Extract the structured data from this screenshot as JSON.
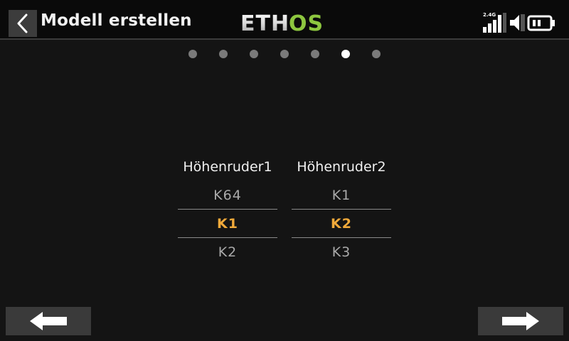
{
  "header": {
    "title": "Modell erstellen",
    "brand": {
      "part1": "ETH",
      "part2": "OS"
    },
    "band_label": "2.4G"
  },
  "pager": {
    "count": 7,
    "active_index": 5
  },
  "pickers": [
    {
      "header": "Höhenruder1",
      "prev": "K64",
      "selected": "K1",
      "next": "K2"
    },
    {
      "header": "Höhenruder2",
      "prev": "K1",
      "selected": "K2",
      "next": "K3"
    }
  ],
  "colors": {
    "accent": "#f0a93a",
    "brand_green": "#8dc63f"
  },
  "icons": {
    "back": "chevron-left-icon",
    "prev": "arrow-left-icon",
    "next": "arrow-right-icon",
    "signal": "signal-bars-icon",
    "volume": "volume-icon",
    "battery": "battery-icon"
  }
}
